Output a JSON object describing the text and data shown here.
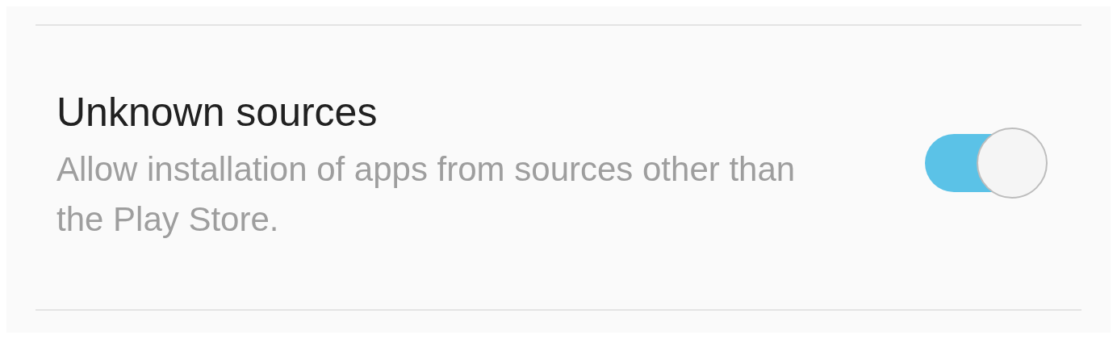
{
  "setting": {
    "title": "Unknown sources",
    "description": "Allow installation of apps from sources other than the Play Store.",
    "on": true
  }
}
